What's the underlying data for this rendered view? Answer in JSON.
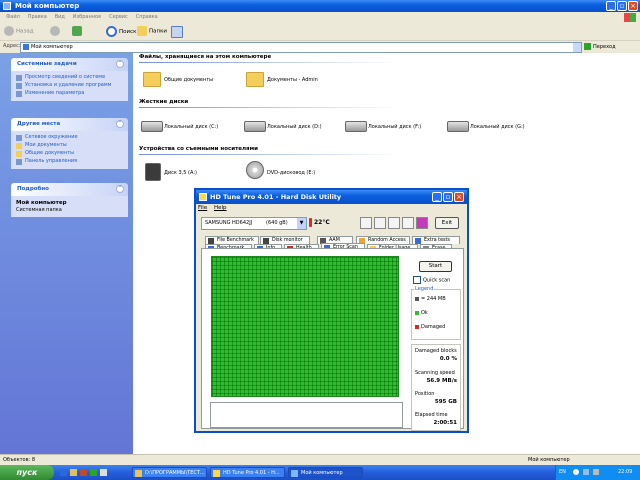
{
  "explorer": {
    "title": "Мой компьютер",
    "menu": [
      "Файл",
      "Правка",
      "Вид",
      "Избранное",
      "Сервис",
      "Справка"
    ],
    "toolbar": {
      "back": "Назад",
      "search": "Поиск",
      "folders": "Папки"
    },
    "address": {
      "label": "Адрес:",
      "value": "Мой компьютер",
      "go": "Переход"
    },
    "tasks_panel": {
      "title": "Системные задачи",
      "items": [
        "Просмотр сведений о системе",
        "Установка и удаление программ",
        "Изменение параметра"
      ]
    },
    "places_panel": {
      "title": "Другие места",
      "items": [
        "Сетевое окружение",
        "Мои документы",
        "Общие документы",
        "Панель управления"
      ]
    },
    "details_panel": {
      "title": "Подробно",
      "name": "Мой компьютер",
      "sub": "Системная папка"
    },
    "groups": {
      "files": {
        "title": "Файлы, хранящиеся на этом компьютере",
        "items": [
          "Общие документы",
          "Документы - Admin"
        ]
      },
      "drives": {
        "title": "Жесткие диски",
        "items": [
          "Локальный диск (C:)",
          "Локальный диск (D:)",
          "Локальный диск (F:)",
          "Локальный диск (G:)"
        ]
      },
      "removable": {
        "title": "Устройства со съемными носителями",
        "items": [
          "Диск 3,5 (A:)",
          "DVD-дисковод (E:)"
        ]
      }
    },
    "status": {
      "left": "Объектов: 8",
      "right": "Мой компьютер"
    }
  },
  "taskbar": {
    "start": "пуск",
    "tasks": [
      "D:\\ПРОГРАММЫ\\ТЕСТ...",
      "HD Tune Pro 4.01 - H...",
      "Мой компьютер"
    ],
    "lang": "EN",
    "time": "22:09"
  },
  "hdtune": {
    "title": "HD Tune Pro 4.01 - Hard Disk Utility",
    "menu": [
      "File",
      "Help"
    ],
    "drive_name": "SAMSUNG HD642JJ",
    "drive_size": "(640 gB)",
    "temp": "22°C",
    "exit": "Exit",
    "tabs_row1": [
      "File Benchmark",
      "Disk monitor",
      "AAM",
      "Random Access",
      "Extra tests"
    ],
    "tabs_row2": [
      "Benchmark",
      "Info",
      "Health",
      "Error Scan",
      "Folder Usage",
      "Erase"
    ],
    "active_tab": "Error Scan",
    "start": "Start",
    "quick_scan": "Quick scan",
    "legend": {
      "title": "Legend",
      "block": "= 244 MB",
      "ok": "Ok",
      "damaged": "Damaged"
    },
    "stats": {
      "damaged_label": "Damaged blocks",
      "damaged_value": "0.0 %",
      "speed_label": "Scanning speed",
      "speed_value": "56.9 MB/s",
      "position_label": "Position",
      "position_value": "595 GB",
      "elapsed_label": "Elapsed time",
      "elapsed_value": "2:00:51"
    },
    "colors": {
      "ok": "#2fbd32",
      "damaged": "#d62a2a"
    }
  }
}
